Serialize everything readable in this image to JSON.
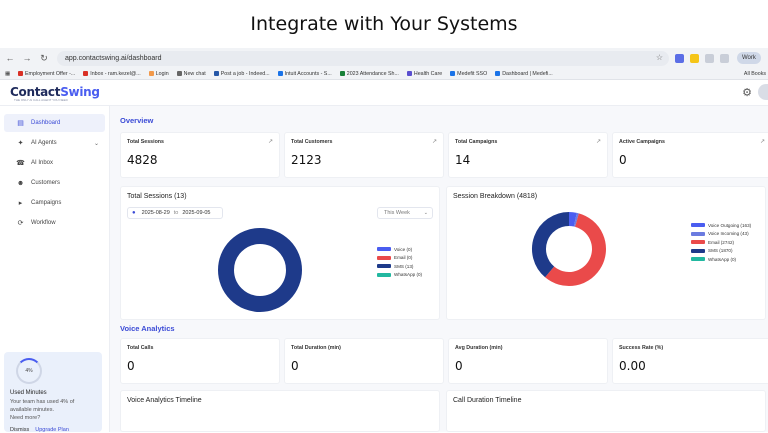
{
  "banner": {
    "title": "Integrate with Your Systems"
  },
  "browser": {
    "url": "app.contactswing.ai/dashboard",
    "profile": "Work",
    "bookmarks": [
      {
        "label": "Employment Offer -...",
        "color": "#d93025"
      },
      {
        "label": "Inbox - ram.kezel@...",
        "color": "#d93025"
      },
      {
        "label": "Login",
        "color": "#f2994a"
      },
      {
        "label": "New chat",
        "color": "#666666"
      },
      {
        "label": "Post a job - Indeed...",
        "color": "#2557a7"
      },
      {
        "label": "Intuit Accounts - S...",
        "color": "#1a73e8"
      },
      {
        "label": "2023 Attendance Sh...",
        "color": "#188038"
      },
      {
        "label": "Health Care",
        "color": "#5a4fcf"
      },
      {
        "label": "Medefit SSO",
        "color": "#1a73e8"
      },
      {
        "label": "Dashboard | Medefi...",
        "color": "#1a73e8"
      }
    ],
    "all_bookmarks": "All Books"
  },
  "app": {
    "logo_main": "Contact",
    "logo_accent": "Swing",
    "logo_tagline": "THE ONLY AI CALL AGENT YOU NEED"
  },
  "sidebar": {
    "items": [
      {
        "label": "Dashboard",
        "icon": "dashboard-icon"
      },
      {
        "label": "AI Agents",
        "icon": "agent-icon"
      },
      {
        "label": "AI Inbox",
        "icon": "phone-icon"
      },
      {
        "label": "Customers",
        "icon": "users-icon"
      },
      {
        "label": "Campaigns",
        "icon": "megaphone-icon"
      },
      {
        "label": "Workflow",
        "icon": "workflow-icon"
      }
    ],
    "usage": {
      "percent_label": "4%",
      "percent": 4,
      "title": "Used Minutes",
      "text": "Your team has used 4% of available minutes.",
      "need_more": "Need more?",
      "dismiss": "Dismiss",
      "upgrade": "Upgrade Plan"
    }
  },
  "overview": {
    "title": "Overview",
    "stats": [
      {
        "label": "Total Sessions",
        "value": "4828"
      },
      {
        "label": "Total Customers",
        "value": "2123"
      },
      {
        "label": "Total Campaigns",
        "value": "14"
      },
      {
        "label": "Active Campaigns",
        "value": "0"
      }
    ]
  },
  "total_sessions_panel": {
    "title": "Total Sessions (13)",
    "date_from": "2025-08-29",
    "date_to_label": "to",
    "date_to": "2025-09-05",
    "range": "This Week",
    "legend": [
      {
        "label": "Voice (0)",
        "color": "#4a5df0"
      },
      {
        "label": "Email (0)",
        "color": "#ea4a4a"
      },
      {
        "label": "SMS (13)",
        "color": "#1e3a8a"
      },
      {
        "label": "WhatsApp (0)",
        "color": "#22b8a0"
      }
    ]
  },
  "session_breakdown_panel": {
    "title": "Session Breakdown (4818)",
    "legend": [
      {
        "label": "Voice Outgoing (163)",
        "color": "#4a5df0"
      },
      {
        "label": "Voice Incoming (43)",
        "color": "#6b7be0"
      },
      {
        "label": "Email (2742)",
        "color": "#ea4a4a"
      },
      {
        "label": "SMS (1870)",
        "color": "#1e3a8a"
      },
      {
        "label": "WhatsApp (0)",
        "color": "#22b8a0"
      }
    ]
  },
  "chart_data": [
    {
      "type": "pie",
      "title": "Total Sessions (13)",
      "categories": [
        "Voice",
        "Email",
        "SMS",
        "WhatsApp"
      ],
      "values": [
        0,
        0,
        13,
        0
      ],
      "colors": [
        "#4a5df0",
        "#ea4a4a",
        "#1e3a8a",
        "#22b8a0"
      ]
    },
    {
      "type": "pie",
      "title": "Session Breakdown (4818)",
      "categories": [
        "Voice Outgoing",
        "Voice Incoming",
        "Email",
        "SMS",
        "WhatsApp"
      ],
      "values": [
        163,
        43,
        2742,
        1870,
        0
      ],
      "colors": [
        "#4a5df0",
        "#6b7be0",
        "#ea4a4a",
        "#1e3a8a",
        "#22b8a0"
      ]
    }
  ],
  "voice_analytics": {
    "title": "Voice Analytics",
    "stats": [
      {
        "label": "Total Calls",
        "value": "0"
      },
      {
        "label": "Total Duration (min)",
        "value": "0"
      },
      {
        "label": "Avg Duration (min)",
        "value": "0"
      },
      {
        "label": "Success Rate (%)",
        "value": "0.00"
      }
    ],
    "timeline_title": "Voice Analytics Timeline",
    "call_duration_title": "Call Duration Timeline"
  }
}
